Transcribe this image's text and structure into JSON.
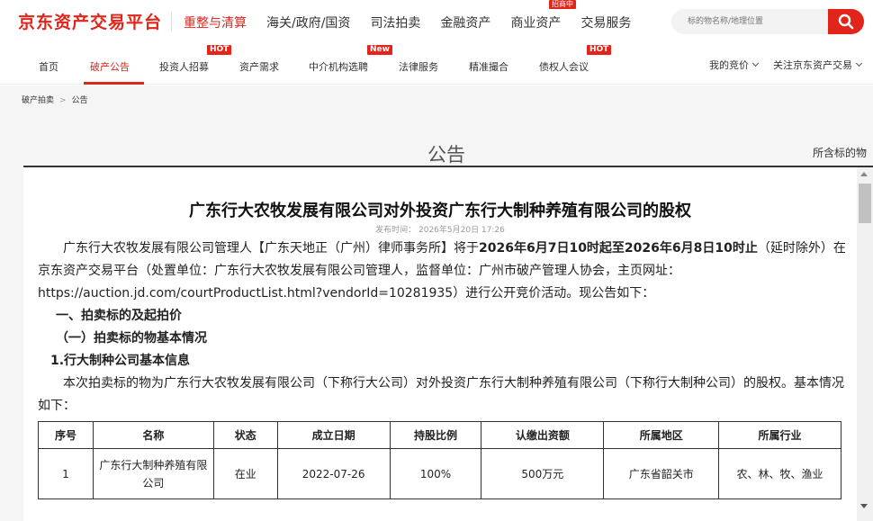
{
  "brand": {
    "logo": "京东资产交易平台",
    "accent": "#e1251b"
  },
  "topnav": {
    "items": [
      "重整与清算",
      "海关/政府/国资",
      "司法拍卖",
      "金融资产",
      "商业资产",
      "交易服务"
    ],
    "badge": "招商中"
  },
  "search": {
    "placeholder": "标的物名称/地理位置",
    "icon": "search-icon"
  },
  "subnav": {
    "items": [
      "首页",
      "破产公告",
      "投资人招募",
      "资产需求",
      "中介机构选聘",
      "法律服务",
      "精准撮合",
      "债权人会议"
    ],
    "tags": {
      "hot1": "HOT",
      "new": "New",
      "hot2": "HOT"
    },
    "my_bids": "我的竞价",
    "follow": "关注京东资产交易"
  },
  "breadcrumb": {
    "first": "破产拍卖",
    "current": "公告"
  },
  "page": {
    "heading": "公告",
    "sidebar_title": "所含标的物"
  },
  "article": {
    "title": "广东行大农牧发展有限公司对外投资广东行大制种养殖有限公司的股权",
    "publish_time": "发布时间： 2026年5月20日 17:26",
    "p1_a": "广东行大农牧发展有限公司管理人【广东天地正（广州）律师事务所】将于",
    "p1_b": "2026年6月7日10时起至2026年6月8日10时止",
    "p1_c": "（延时除外）在京东资产交易平台（处置单位：广东行大农牧发展有限公司管理人，监督单位：广州市破产管理人协会，主页网址：https://auction.jd.com/courtProductList.html?vendorId=10281935）进行公开竞价活动。现公告如下：",
    "section1": "一、拍卖标的及起拍价",
    "section2": "（一）拍卖标的物基本情况",
    "section3": "1.行大制种公司基本信息",
    "p2": "本次拍卖标的物为广东行大农牧发展有限公司（下称行大公司）对外投资广东行大制种养殖有限公司（下称行大制种公司）的股权。基本情况如下："
  },
  "table": {
    "headers": [
      "序号",
      "名称",
      "状态",
      "成立日期",
      "持股比例",
      "认缴出资额",
      "所属地区",
      "所属行业"
    ],
    "rows": [
      [
        "1",
        "广东行大制种养殖有限公司",
        "在业",
        "2022-07-26",
        "100%",
        "500万元",
        "广东省韶关市",
        "农、林、牧、渔业"
      ]
    ]
  }
}
